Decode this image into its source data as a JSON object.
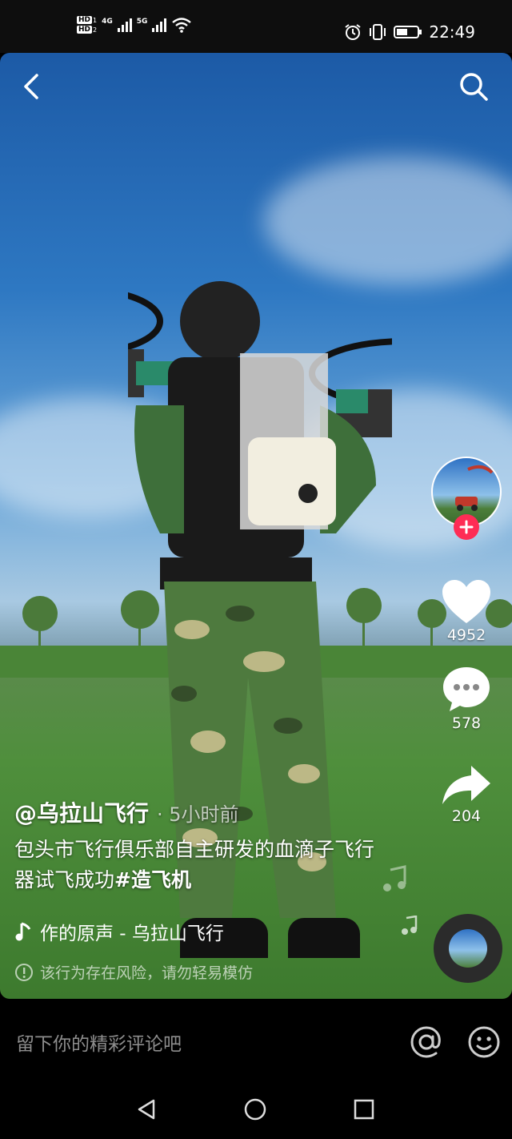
{
  "status_bar": {
    "hd1": "HD",
    "sim1": "1",
    "hd2": "HD",
    "sim2": "2",
    "net1": "4G",
    "net2": "5G",
    "time": "22:49"
  },
  "video": {
    "author": "@乌拉山飞行",
    "time_ago": "· 5小时前",
    "description": "包头市飞行俱乐部自主研发的血滴子飞行器试飞成功",
    "hashtag": "#造飞机",
    "music": "作的原声 - 乌拉山飞行",
    "warning": "该行为存在风险，请勿轻易模仿"
  },
  "actions": {
    "likes": "4952",
    "comments": "578",
    "shares": "204"
  },
  "comment_bar": {
    "placeholder": "留下你的精彩评论吧"
  },
  "icons": [
    "back-icon",
    "search-icon",
    "heart-icon",
    "comment-icon",
    "share-icon",
    "music-note-icon",
    "warning-icon",
    "at-icon",
    "emoji-icon",
    "follow-plus-icon"
  ],
  "colors": {
    "accent": "#fe2c55",
    "background": "#000000"
  }
}
